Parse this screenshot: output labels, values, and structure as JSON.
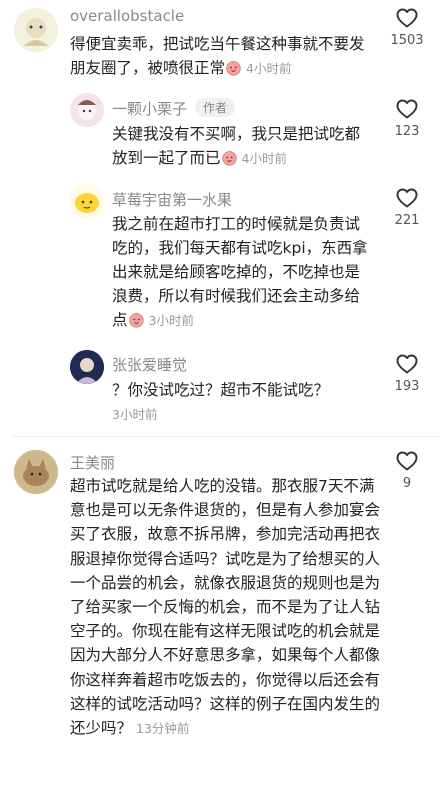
{
  "comments": [
    {
      "user": "overallobstacle",
      "text": "得便宜卖乖，把试吃当午餐这种事就不要发朋友圈了，被喷很正常",
      "time": "4小时前",
      "likes": "1503"
    },
    {
      "user": "一颗小栗子",
      "badge": "作者",
      "text": "关键我没有不买啊，我只是把试吃都放到一起了而已",
      "time": "4小时前",
      "likes": "123"
    },
    {
      "user": "草莓宇宙第一水果",
      "text": "我之前在超市打工的时候就是负责试吃的，我们每天都有试吃kpi，东西拿出来就是给顾客吃掉的，不吃掉也是浪费，所以有时候我们还会主动多给点",
      "time": "3小时前",
      "likes": "221"
    },
    {
      "user": "张张爱睡觉",
      "text": "？你没试吃过？超市不能试吃？",
      "time": "3小时前",
      "likes": "193"
    },
    {
      "user": "王美丽",
      "text": "超市试吃就是给人吃的没错。那衣服7天不满意也是可以无条件退货的，但是有人参加宴会买了衣服，故意不拆吊牌，参加完活动再把衣服退掉你觉得合适吗？试吃是为了给想买的人一个品尝的机会，就像衣服退货的规则也是为了给买家一个反悔的机会，而不是为了让人钻空子的。你现在能有这样无限试吃的机会就是因为大部分人不好意思多拿，如果每个人都像你这样奔着超市吃饭去的，你觉得以后还会有这样的试吃活动吗？这样的例子在国内发生的还少吗？",
      "time": "13分钟前",
      "likes": "9"
    }
  ],
  "icons": {
    "like": "heart-outline-icon",
    "emoji": "peach-emoji-icon"
  }
}
